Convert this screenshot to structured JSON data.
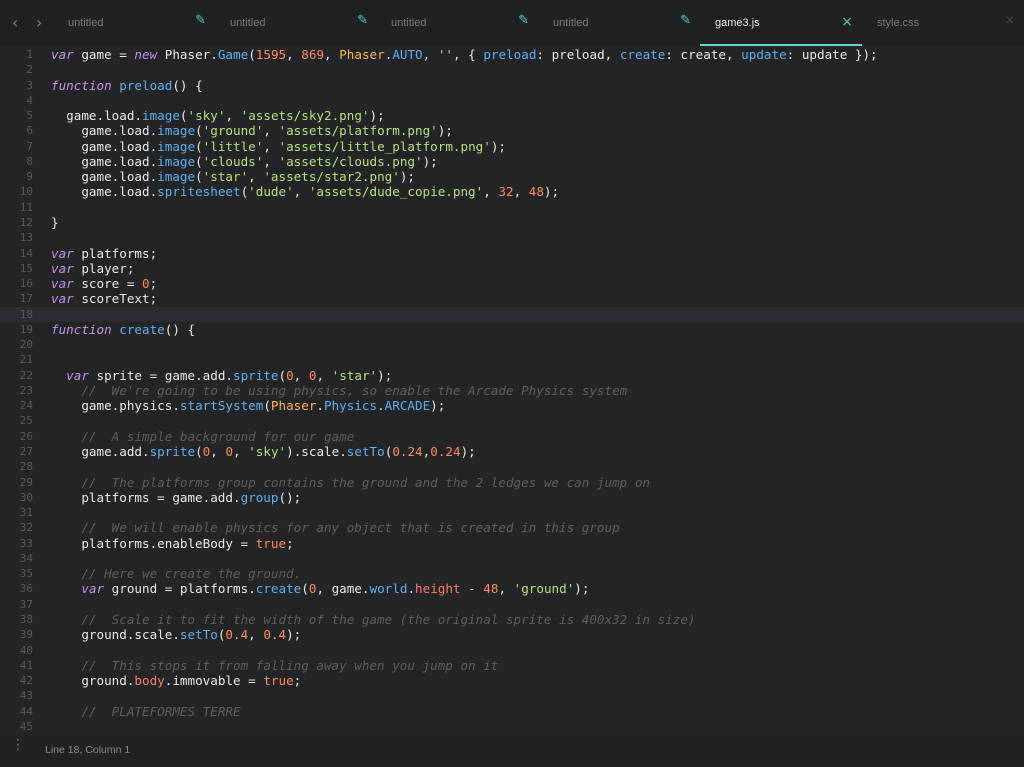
{
  "tabs": [
    {
      "label": "untitled",
      "icon": "pencil-icon",
      "active": false
    },
    {
      "label": "untitled",
      "icon": "pencil-icon",
      "active": false
    },
    {
      "label": "untitled",
      "icon": "pencil-icon",
      "active": false
    },
    {
      "label": "untitled",
      "icon": "pencil-icon",
      "active": false
    },
    {
      "label": "game3.js",
      "icon": "close-icon",
      "active": true
    },
    {
      "label": "style.css",
      "icon": "close-icon",
      "active": false
    }
  ],
  "icons": {
    "back": "‹",
    "forward": "›",
    "pencil": "✎",
    "close": "×"
  },
  "editor": {
    "current_line": 18,
    "lines": [
      [
        [
          "kw",
          "var"
        ],
        [
          "t",
          " game = "
        ],
        [
          "kw",
          "new"
        ],
        [
          "t",
          " Phaser."
        ],
        [
          "fn",
          "Game"
        ],
        [
          "t",
          "("
        ],
        [
          "num",
          "1595"
        ],
        [
          "t",
          ", "
        ],
        [
          "num",
          "869"
        ],
        [
          "t",
          ", "
        ],
        [
          "ct",
          "Phaser"
        ],
        [
          "t",
          "."
        ],
        [
          "fn",
          "AUTO"
        ],
        [
          "t",
          ", "
        ],
        [
          "str",
          "''"
        ],
        [
          "t",
          ", { "
        ],
        [
          "fn",
          "preload"
        ],
        [
          "t",
          ": preload, "
        ],
        [
          "fn",
          "create"
        ],
        [
          "t",
          ": create, "
        ],
        [
          "fn",
          "update"
        ],
        [
          "t",
          ": update });"
        ]
      ],
      [],
      [
        [
          "kw",
          "function"
        ],
        [
          "t",
          " "
        ],
        [
          "fn",
          "preload"
        ],
        [
          "t",
          "() {"
        ]
      ],
      [],
      [
        [
          "t",
          "  game.load."
        ],
        [
          "fn",
          "image"
        ],
        [
          "t",
          "("
        ],
        [
          "str",
          "'sky'"
        ],
        [
          "t",
          ", "
        ],
        [
          "str",
          "'assets/sky2.png'"
        ],
        [
          "t",
          ");"
        ]
      ],
      [
        [
          "t",
          "    game.load."
        ],
        [
          "fn",
          "image"
        ],
        [
          "t",
          "("
        ],
        [
          "str",
          "'ground'"
        ],
        [
          "t",
          ", "
        ],
        [
          "str",
          "'assets/platform.png'"
        ],
        [
          "t",
          ");"
        ]
      ],
      [
        [
          "t",
          "    game.load."
        ],
        [
          "fn",
          "image"
        ],
        [
          "t",
          "("
        ],
        [
          "str",
          "'little'"
        ],
        [
          "t",
          ", "
        ],
        [
          "str",
          "'assets/little_platform.png'"
        ],
        [
          "t",
          ");"
        ]
      ],
      [
        [
          "t",
          "    game.load."
        ],
        [
          "fn",
          "image"
        ],
        [
          "t",
          "("
        ],
        [
          "str",
          "'clouds'"
        ],
        [
          "t",
          ", "
        ],
        [
          "str",
          "'assets/clouds.png'"
        ],
        [
          "t",
          ");"
        ]
      ],
      [
        [
          "t",
          "    game.load."
        ],
        [
          "fn",
          "image"
        ],
        [
          "t",
          "("
        ],
        [
          "str",
          "'star'"
        ],
        [
          "t",
          ", "
        ],
        [
          "str",
          "'assets/star2.png'"
        ],
        [
          "t",
          ");"
        ]
      ],
      [
        [
          "t",
          "    game.load."
        ],
        [
          "fn",
          "spritesheet"
        ],
        [
          "t",
          "("
        ],
        [
          "str",
          "'dude'"
        ],
        [
          "t",
          ", "
        ],
        [
          "str",
          "'assets/dude_copie.png'"
        ],
        [
          "t",
          ", "
        ],
        [
          "num",
          "32"
        ],
        [
          "t",
          ", "
        ],
        [
          "num",
          "48"
        ],
        [
          "t",
          ");"
        ]
      ],
      [],
      [
        [
          "t",
          "}"
        ]
      ],
      [],
      [
        [
          "kw",
          "var"
        ],
        [
          "t",
          " platforms;"
        ]
      ],
      [
        [
          "kw",
          "var"
        ],
        [
          "t",
          " player;"
        ]
      ],
      [
        [
          "kw",
          "var"
        ],
        [
          "t",
          " score = "
        ],
        [
          "num",
          "0"
        ],
        [
          "t",
          ";"
        ]
      ],
      [
        [
          "kw",
          "var"
        ],
        [
          "t",
          " scoreText;"
        ]
      ],
      [],
      [
        [
          "kw",
          "function"
        ],
        [
          "t",
          " "
        ],
        [
          "fn",
          "create"
        ],
        [
          "t",
          "() {"
        ]
      ],
      [],
      [],
      [
        [
          "t",
          "  "
        ],
        [
          "kw",
          "var"
        ],
        [
          "t",
          " sprite = game.add."
        ],
        [
          "fn",
          "sprite"
        ],
        [
          "t",
          "("
        ],
        [
          "num",
          "0"
        ],
        [
          "t",
          ", "
        ],
        [
          "num",
          "0"
        ],
        [
          "t",
          ", "
        ],
        [
          "str",
          "'star'"
        ],
        [
          "t",
          ");"
        ]
      ],
      [
        [
          "t",
          "    "
        ],
        [
          "cm",
          "//  We're going to be using physics, so enable the Arcade Physics system"
        ]
      ],
      [
        [
          "t",
          "    game.physics."
        ],
        [
          "fn",
          "startSystem"
        ],
        [
          "t",
          "("
        ],
        [
          "ct",
          "Phaser"
        ],
        [
          "t",
          "."
        ],
        [
          "fn",
          "Physics"
        ],
        [
          "t",
          "."
        ],
        [
          "fn",
          "ARCADE"
        ],
        [
          "t",
          ");"
        ]
      ],
      [],
      [
        [
          "t",
          "    "
        ],
        [
          "cm",
          "//  A simple background for our game"
        ]
      ],
      [
        [
          "t",
          "    game.add."
        ],
        [
          "fn",
          "sprite"
        ],
        [
          "t",
          "("
        ],
        [
          "num",
          "0"
        ],
        [
          "t",
          ", "
        ],
        [
          "num",
          "0"
        ],
        [
          "t",
          ", "
        ],
        [
          "str",
          "'sky'"
        ],
        [
          "t",
          ").scale."
        ],
        [
          "fn",
          "setTo"
        ],
        [
          "t",
          "("
        ],
        [
          "num",
          "0.24"
        ],
        [
          "t",
          ","
        ],
        [
          "num",
          "0.24"
        ],
        [
          "t",
          ");"
        ]
      ],
      [],
      [
        [
          "t",
          "    "
        ],
        [
          "cm",
          "//  The platforms group contains the ground and the 2 ledges we can jump on"
        ]
      ],
      [
        [
          "t",
          "    platforms = game.add."
        ],
        [
          "fn",
          "group"
        ],
        [
          "t",
          "();"
        ]
      ],
      [],
      [
        [
          "t",
          "    "
        ],
        [
          "cm",
          "//  We will enable physics for any object that is created in this group"
        ]
      ],
      [
        [
          "t",
          "    platforms.enableBody = "
        ],
        [
          "num",
          "true"
        ],
        [
          "t",
          ";"
        ]
      ],
      [],
      [
        [
          "t",
          "    "
        ],
        [
          "cm",
          "// Here we create the ground."
        ]
      ],
      [
        [
          "t",
          "    "
        ],
        [
          "kw",
          "var"
        ],
        [
          "t",
          " ground = platforms."
        ],
        [
          "fn",
          "create"
        ],
        [
          "t",
          "("
        ],
        [
          "num",
          "0"
        ],
        [
          "t",
          ", game."
        ],
        [
          "fn",
          "world"
        ],
        [
          "t",
          "."
        ],
        [
          "prop",
          "height"
        ],
        [
          "t",
          " - "
        ],
        [
          "num",
          "48"
        ],
        [
          "t",
          ", "
        ],
        [
          "str",
          "'ground'"
        ],
        [
          "t",
          ");"
        ]
      ],
      [],
      [
        [
          "t",
          "    "
        ],
        [
          "cm",
          "//  Scale it to fit the width of the game (the original sprite is 400x32 in size)"
        ]
      ],
      [
        [
          "t",
          "    ground.scale."
        ],
        [
          "fn",
          "setTo"
        ],
        [
          "t",
          "("
        ],
        [
          "num",
          "0.4"
        ],
        [
          "t",
          ", "
        ],
        [
          "num",
          "0.4"
        ],
        [
          "t",
          ");"
        ]
      ],
      [],
      [
        [
          "t",
          "    "
        ],
        [
          "cm",
          "//  This stops it from falling away when you jump on it"
        ]
      ],
      [
        [
          "t",
          "    ground."
        ],
        [
          "prop",
          "body"
        ],
        [
          "t",
          ".immovable = "
        ],
        [
          "num",
          "true"
        ],
        [
          "t",
          ";"
        ]
      ],
      [],
      [
        [
          "t",
          "    "
        ],
        [
          "cm",
          "//  PLATEFORMES TERRE"
        ]
      ],
      []
    ]
  },
  "statusbar": {
    "text": "Line 18, Column 1",
    "menu_icon": "⋮"
  }
}
